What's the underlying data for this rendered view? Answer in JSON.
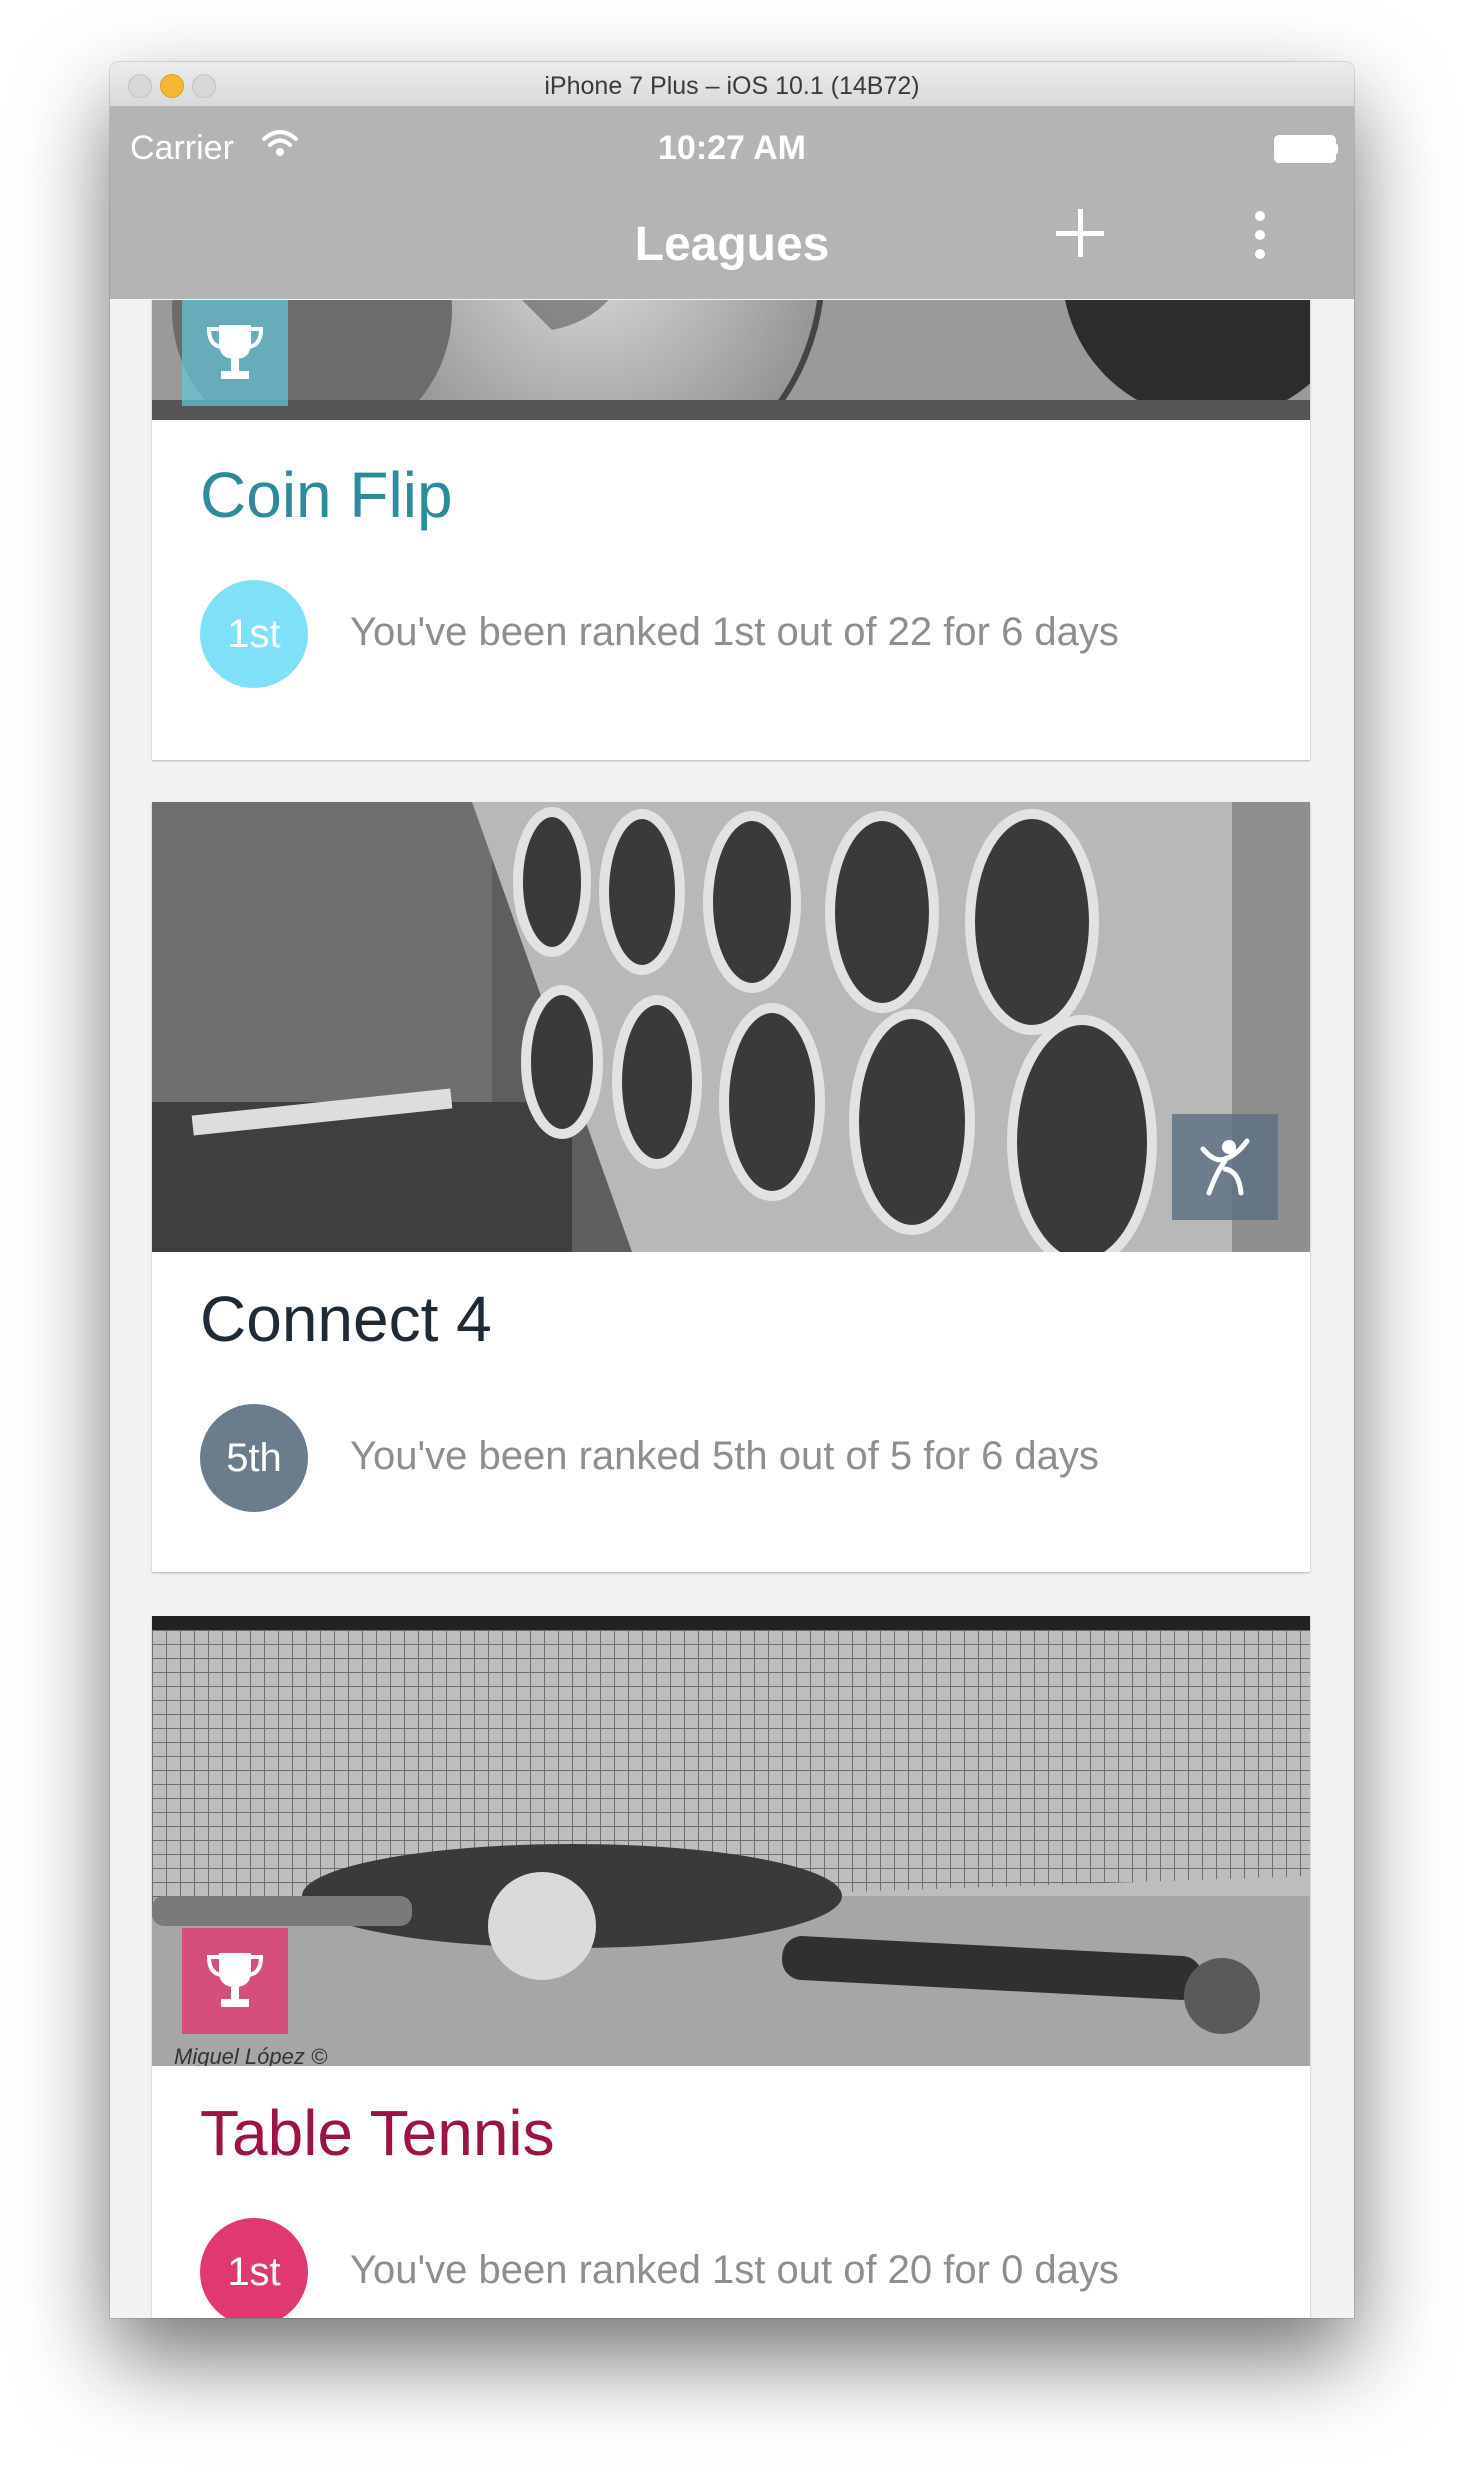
{
  "window": {
    "title": "iPhone 7 Plus – iOS 10.1 (14B72)"
  },
  "status_bar": {
    "carrier": "Carrier",
    "time": "10:27 AM"
  },
  "nav": {
    "title": "Leagues",
    "add_icon": "plus-icon",
    "more_icon": "vertical-dots-icon"
  },
  "colors": {
    "app_bar": "#b4b4b4",
    "coin_flip": "#2f8a9c",
    "coin_flip_rank": "#7fe0f8",
    "connect4": "#1e2a36",
    "connect4_rank": "#6b7d8c",
    "table_tennis": "#9c1346",
    "table_tennis_rank": "#e0396f"
  },
  "leagues": [
    {
      "name": "Coin Flip",
      "rank": "1st",
      "summary": "You've been ranked 1st out of 22 for 6 days",
      "badge_icon": "trophy-icon"
    },
    {
      "name": "Connect 4",
      "rank": "5th",
      "summary": "You've been ranked 5th out of 5 for 6 days",
      "badge_icon": "person-icon"
    },
    {
      "name": "Table Tennis",
      "rank": "1st",
      "summary": "You've been ranked 1st out of 20 for 0 days",
      "badge_icon": "trophy-icon",
      "image_credit": "Miguel López ©"
    }
  ]
}
